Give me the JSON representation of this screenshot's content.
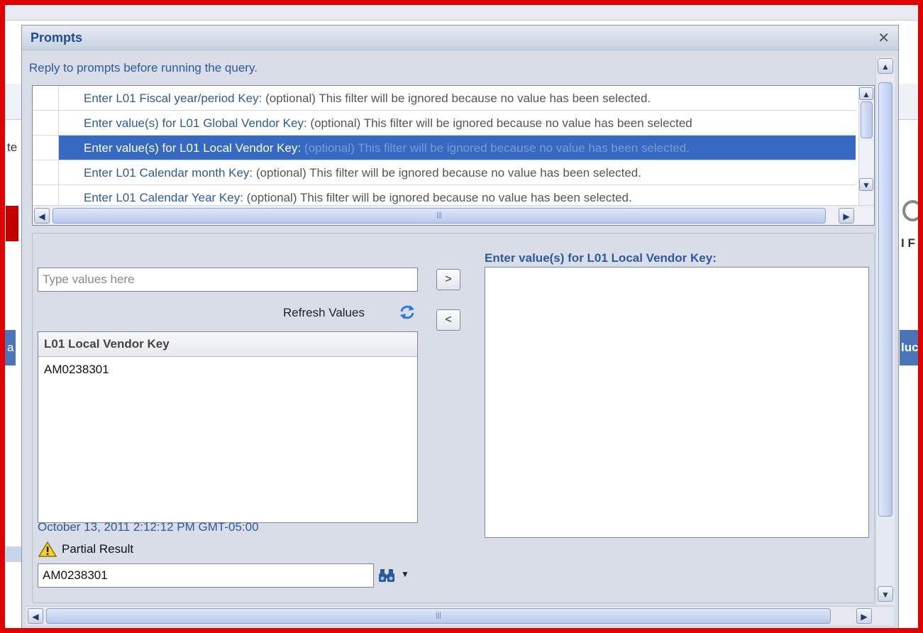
{
  "dialog": {
    "title": "Prompts",
    "subtitle": "Reply to prompts before running the query.",
    "close_glyph": "✕"
  },
  "prompts": [
    {
      "key": "Enter L01 Fiscal year/period Key:",
      "status": " (optional) This filter will be ignored because no value has been selected.",
      "selected": false
    },
    {
      "key": "Enter value(s) for L01 Global Vendor Key:",
      "status": " (optional) This filter will be ignored because no value has been selected",
      "selected": false
    },
    {
      "key": "Enter value(s) for L01 Local Vendor Key:",
      "status": " (optional) This filter will be ignored because no value has been selected.",
      "selected": true
    },
    {
      "key": "Enter L01 Calendar month Key:",
      "status": " (optional) This filter will be ignored because no value has been selected.",
      "selected": false
    },
    {
      "key": "Enter L01 Calendar Year Key:",
      "status": " (optional) This filter will be ignored because no value has been selected.",
      "selected": false
    }
  ],
  "value_picker": {
    "search_placeholder": "Type values here",
    "refresh_label": "Refresh Values",
    "add_glyph": ">",
    "remove_glyph": "<",
    "column_header": "L01 Local Vendor Key",
    "values": [
      "AM0238301"
    ],
    "timestamp": "October 13, 2011 2:12:12 PM GMT-05:00",
    "partial_label": "Partial Result",
    "search_value": "AM0238301"
  },
  "selected_panel": {
    "label": "Enter value(s) for L01 Local Vendor Key:"
  },
  "scrollbar": {
    "up": "▲",
    "down": "▼",
    "left": "◀",
    "right": "▶",
    "grip": "|||"
  },
  "background": {
    "edge_texts": [
      "te",
      "a",
      "luc",
      "I F"
    ]
  },
  "colors": {
    "accent": "#3569c2",
    "link": "#2d5a9a",
    "frame": "#e00000"
  },
  "icons": [
    "close-icon",
    "refresh-icon",
    "warning-icon",
    "binoculars-icon",
    "dropdown-arrow-icon"
  ]
}
